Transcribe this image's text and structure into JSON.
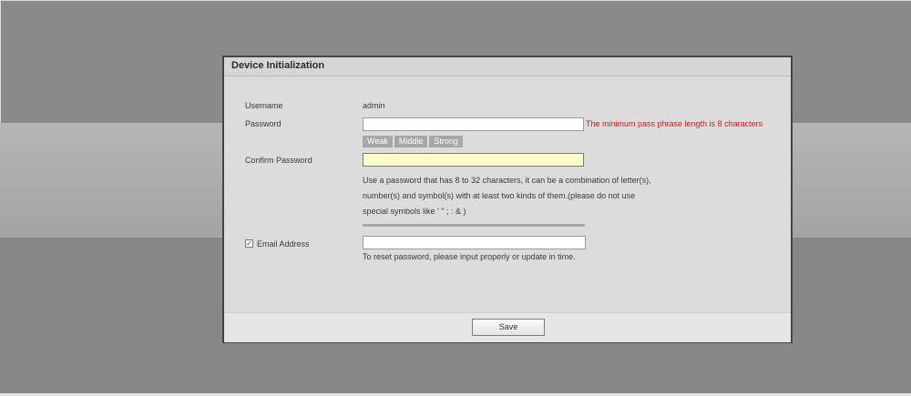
{
  "dialog": {
    "title": "Device Initialization",
    "username_label": "Username",
    "username_value": "admin",
    "password_label": "Password",
    "password_value": "",
    "password_error": "The minimum pass phrase length is 8 characters",
    "strength": [
      "Weak",
      "Middle",
      "Strong"
    ],
    "confirm_password_label": "Confirm Password",
    "confirm_password_value": "",
    "hint_line1": "Use a password that has 8 to 32 characters, it can be a combination of letter(s),",
    "hint_line2": "number(s) and symbol(s) with at least two kinds of them.(please do not use",
    "hint_line3": "special symbols like ' \" ; : & )",
    "email_checkbox_checked": true,
    "email_label": "Email Address",
    "email_value": "",
    "email_hint": "To reset password, please input properly or update in time.",
    "save_label": "Save"
  }
}
